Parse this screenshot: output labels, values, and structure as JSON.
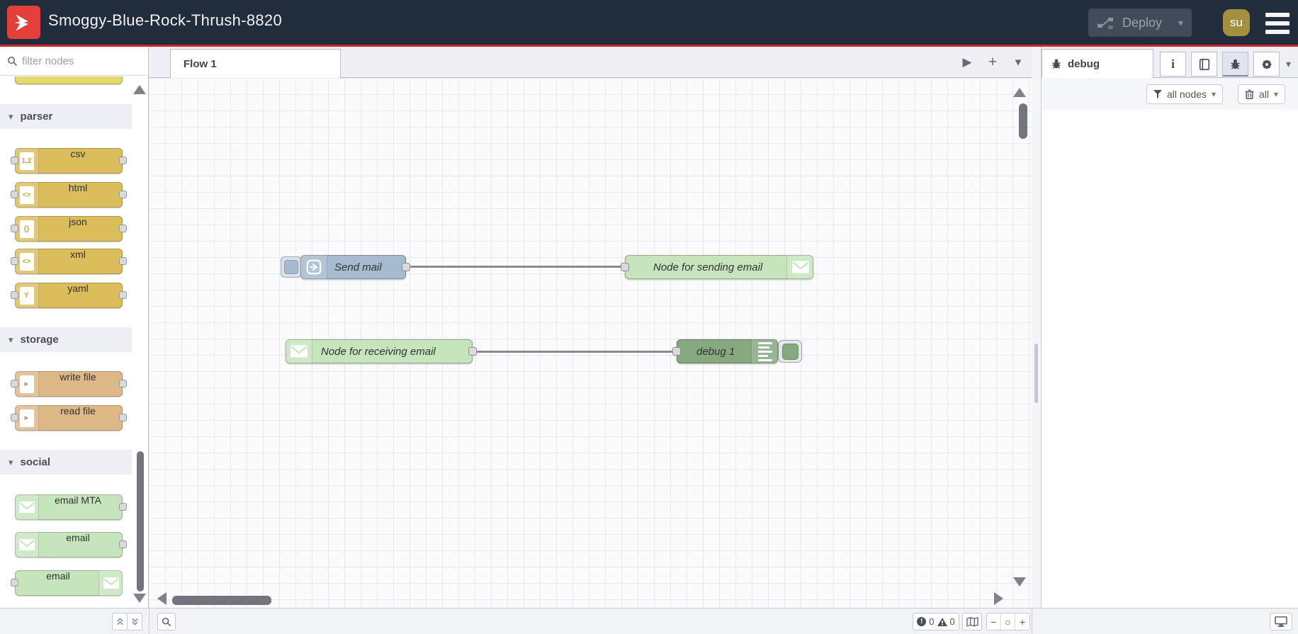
{
  "header": {
    "title": "Smoggy-Blue-Rock-Thrush-8820",
    "deploy_label": "Deploy",
    "avatar_initials": "su"
  },
  "palette": {
    "filter_placeholder": "filter nodes",
    "categories": [
      {
        "label": "parser",
        "nodes": [
          {
            "label": "csv",
            "icon_text": "1,2"
          },
          {
            "label": "html",
            "icon_text": "<>"
          },
          {
            "label": "json",
            "icon_text": "{}"
          },
          {
            "label": "xml",
            "icon_text": "<>"
          },
          {
            "label": "yaml",
            "icon_text": "Y"
          }
        ]
      },
      {
        "label": "storage",
        "nodes": [
          {
            "label": "write file",
            "icon_text": "►"
          },
          {
            "label": "read file",
            "icon_text": "►"
          }
        ]
      },
      {
        "label": "social",
        "nodes": [
          {
            "label": "email MTA"
          },
          {
            "label": "email"
          },
          {
            "label": "email"
          }
        ]
      }
    ]
  },
  "workspace": {
    "tab_label": "Flow 1",
    "nodes": [
      {
        "label": "Send mail",
        "type": "inject"
      },
      {
        "label": "Node for sending email",
        "type": "email-out"
      },
      {
        "label": "Node for receiving email",
        "type": "email-in"
      },
      {
        "label": "debug 1",
        "type": "debug"
      }
    ],
    "footer": {
      "error_count": "0",
      "warning_count": "0"
    }
  },
  "sidebar": {
    "tab_label": "debug",
    "filter_label": "all nodes",
    "clear_label": "all"
  },
  "colors": {
    "header_bg": "#212d3d",
    "accent_red": "#c92b2b",
    "logo_red": "#e2413b",
    "inject_node": "#a6bbcf",
    "email_node": "#c6e5bd",
    "debug_node": "#87a980",
    "parser_node": "#dbbd5c",
    "storage_node": "#deb887"
  }
}
